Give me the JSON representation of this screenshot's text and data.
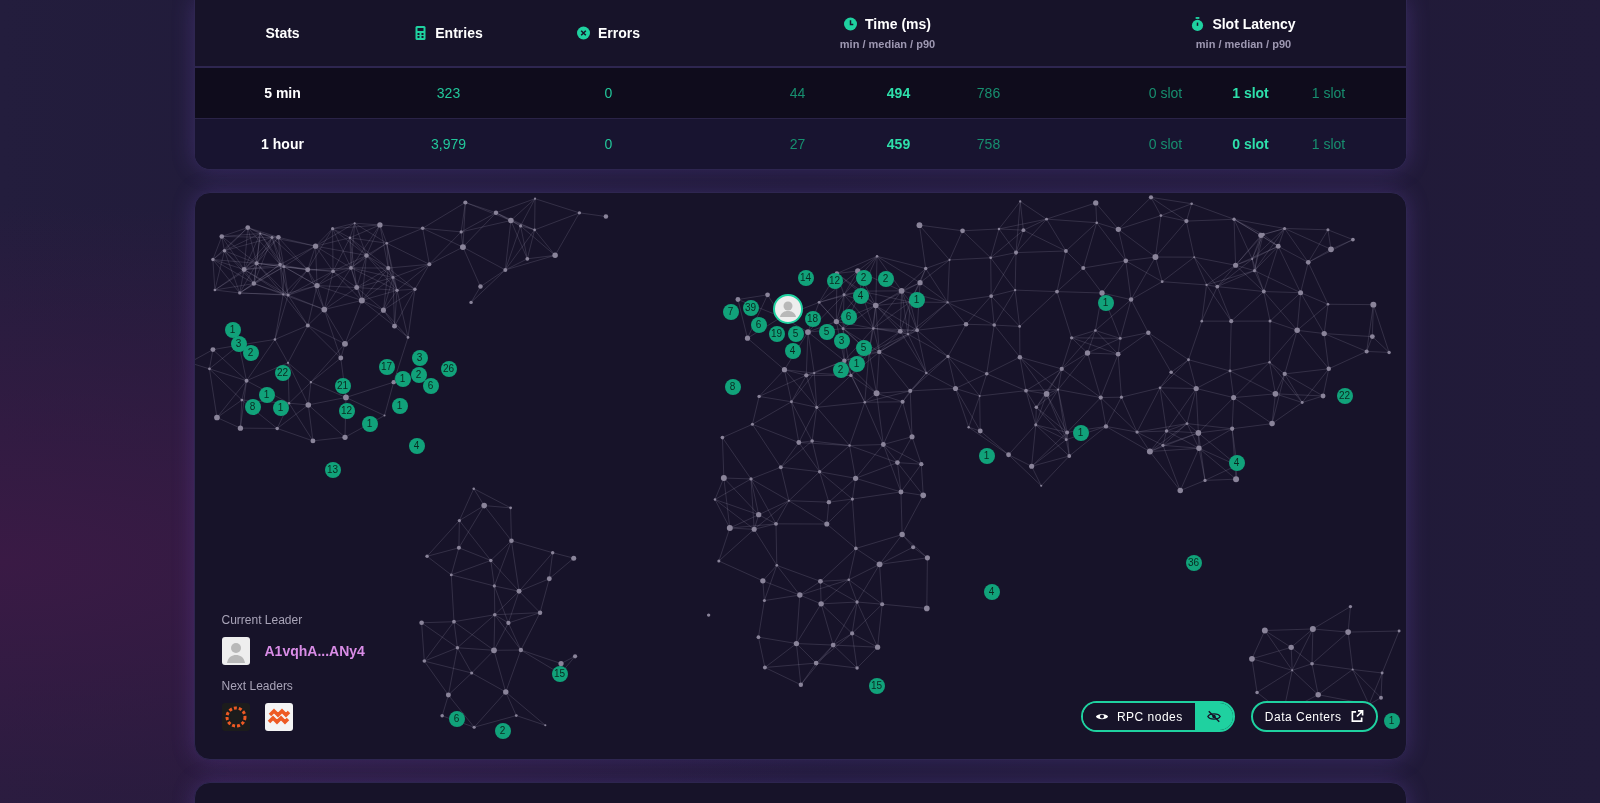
{
  "table": {
    "columns": [
      {
        "label": "Stats",
        "kind": "plain"
      },
      {
        "label": "Entries",
        "kind": "entries"
      },
      {
        "label": "Errors",
        "kind": "errors"
      },
      {
        "label": "Time (ms)",
        "kind": "time",
        "sub": "min / median / p90"
      },
      {
        "label": "Slot Latency",
        "kind": "slot",
        "sub": "min / median / p90"
      }
    ],
    "rows": [
      {
        "label": "5 min",
        "highlighted": true,
        "entries": "323",
        "errors": "0",
        "time": [
          "44",
          "494",
          "786"
        ],
        "slot": [
          "0 slot",
          "1 slot",
          "1 slot"
        ]
      },
      {
        "label": "1 hour",
        "highlighted": false,
        "entries": "3,979",
        "errors": "0",
        "time": [
          "27",
          "459",
          "758"
        ],
        "slot": [
          "0 slot",
          "0 slot",
          "1 slot"
        ]
      }
    ]
  },
  "map": {
    "markers": [
      {
        "count": "1"
      },
      {
        "count": "3"
      },
      {
        "count": "2"
      },
      {
        "count": "22"
      },
      {
        "count": "1"
      },
      {
        "count": "8"
      },
      {
        "count": "1"
      },
      {
        "count": "21"
      },
      {
        "count": "12"
      },
      {
        "count": "1"
      },
      {
        "count": "17"
      },
      {
        "count": "3"
      },
      {
        "count": "1"
      },
      {
        "count": "2"
      },
      {
        "count": "6"
      },
      {
        "count": "26"
      },
      {
        "count": "1"
      },
      {
        "count": "4"
      },
      {
        "count": "13"
      },
      {
        "count": "14"
      },
      {
        "count": "12"
      },
      {
        "count": "2"
      },
      {
        "count": "2"
      },
      {
        "count": "4"
      },
      {
        "count": "1"
      },
      {
        "count": "7"
      },
      {
        "count": "39"
      },
      {
        "count": "6"
      },
      {
        "count": "19"
      },
      {
        "count": "5"
      },
      {
        "count": "4"
      },
      {
        "count": "18"
      },
      {
        "count": "5"
      },
      {
        "count": "3"
      },
      {
        "count": "6"
      },
      {
        "count": "5"
      },
      {
        "count": "1"
      },
      {
        "count": "2"
      },
      {
        "count": "8"
      },
      {
        "count": "1"
      },
      {
        "count": "22"
      },
      {
        "count": "1"
      },
      {
        "count": "1"
      },
      {
        "count": "4"
      },
      {
        "count": "36"
      },
      {
        "count": "4"
      },
      {
        "count": "15"
      },
      {
        "count": "15"
      },
      {
        "count": "6"
      },
      {
        "count": "2"
      },
      {
        "count": "1"
      }
    ],
    "current_leader": {
      "label": "Current Leader",
      "name": "A1vqhA...ANy4"
    },
    "next_leaders": {
      "label": "Next Leaders",
      "avatars": [
        {
          "kind": "sun"
        },
        {
          "kind": "waves"
        }
      ]
    },
    "rpc_toggle": [
      {
        "kind": "show",
        "label": "RPC nodes",
        "selected": false
      },
      {
        "kind": "hide",
        "selected": true
      }
    ],
    "data_centers": {
      "label": "Data Centers"
    }
  }
}
